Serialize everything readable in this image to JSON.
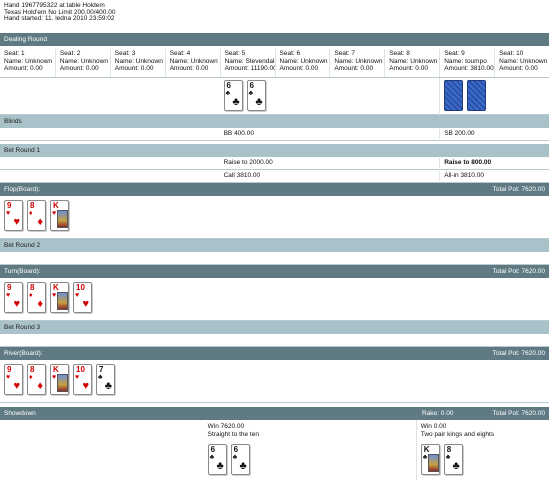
{
  "header": {
    "line1": "Hand 1967795322 at table Holdem",
    "line2": "Texas Hold'em No Limit 200.00/400.00",
    "line3": "Hand started: 11. ledna 2010 23:59:02"
  },
  "dealing": {
    "title": "Dealing Round",
    "seats": [
      {
        "seat": "Seat: 1",
        "name": "Name: Unknown",
        "amount": "Amount: 0.00"
      },
      {
        "seat": "Seat: 2",
        "name": "Name: Unknown",
        "amount": "Amount: 0.00"
      },
      {
        "seat": "Seat: 3",
        "name": "Name: Unknown",
        "amount": "Amount: 0.00"
      },
      {
        "seat": "Seat: 4",
        "name": "Name: Unknown",
        "amount": "Amount: 0.00"
      },
      {
        "seat": "Seat: 5",
        "name": "Name: Stevendall",
        "amount": "Amount: 11190.00"
      },
      {
        "seat": "Seat: 6",
        "name": "Name: Unknown",
        "amount": "Amount: 0.00"
      },
      {
        "seat": "Seat: 7",
        "name": "Name: Unknown",
        "amount": "Amount: 0.00"
      },
      {
        "seat": "Seat: 8",
        "name": "Name: Unknown",
        "amount": "Amount: 0.00"
      },
      {
        "seat": "Seat: 9",
        "name": "Name: toumpo",
        "amount": "Amount: 3810.00"
      },
      {
        "seat": "Seat: 10",
        "name": "Name: Unknown",
        "amount": "Amount: 0.00"
      }
    ],
    "hole_cards": [
      {
        "rank": "6",
        "suit": "♣"
      },
      {
        "rank": "6",
        "suit": "♣"
      }
    ]
  },
  "blinds": {
    "title": "Blinds",
    "bb": "BB 400.00",
    "sb": "SB 200.00"
  },
  "bet1": {
    "title": "Bet Round 1",
    "a1": "Raise to 2000.00",
    "b1": "Raise to 800.00",
    "a2": "Call 3810.00",
    "b2": "All-in 3810.00"
  },
  "flop": {
    "title": "Flop(Board):",
    "pot": "Total Pot: 7620.00",
    "cards": [
      {
        "rank": "9",
        "suit": "♥"
      },
      {
        "rank": "8",
        "suit": "♦"
      },
      {
        "rank": "K",
        "suit": "♥"
      }
    ]
  },
  "bet2": {
    "title": "Bet Round 2"
  },
  "turn": {
    "title": "Turn(Board):",
    "pot": "Total Pot: 7620.00",
    "cards": [
      {
        "rank": "9",
        "suit": "♥"
      },
      {
        "rank": "8",
        "suit": "♦"
      },
      {
        "rank": "K",
        "suit": "♥"
      },
      {
        "rank": "10",
        "suit": "♥"
      }
    ]
  },
  "bet3": {
    "title": "Bet Round 3"
  },
  "river": {
    "title": "River(Board):",
    "pot": "Total Pot: 7620.00",
    "cards": [
      {
        "rank": "9",
        "suit": "♥"
      },
      {
        "rank": "8",
        "suit": "♦"
      },
      {
        "rank": "K",
        "suit": "♥"
      },
      {
        "rank": "10",
        "suit": "♥"
      },
      {
        "rank": "7",
        "suit": "♣"
      }
    ]
  },
  "showdown": {
    "title": "Showdown",
    "rake": "Rake: 0.00",
    "pot": "Total Pot: 7620.00",
    "p5_win": "Win 7620.00",
    "p5_hand": "Straight to the ten",
    "p9_win": "Win 0.00",
    "p9_hand": "Two pair kings and eights",
    "p5_cards": [
      {
        "rank": "6",
        "suit": "♣"
      },
      {
        "rank": "6",
        "suit": "♣"
      }
    ],
    "p9_cards": [
      {
        "rank": "K",
        "suit": "♣"
      },
      {
        "rank": "8",
        "suit": "♣"
      }
    ]
  }
}
